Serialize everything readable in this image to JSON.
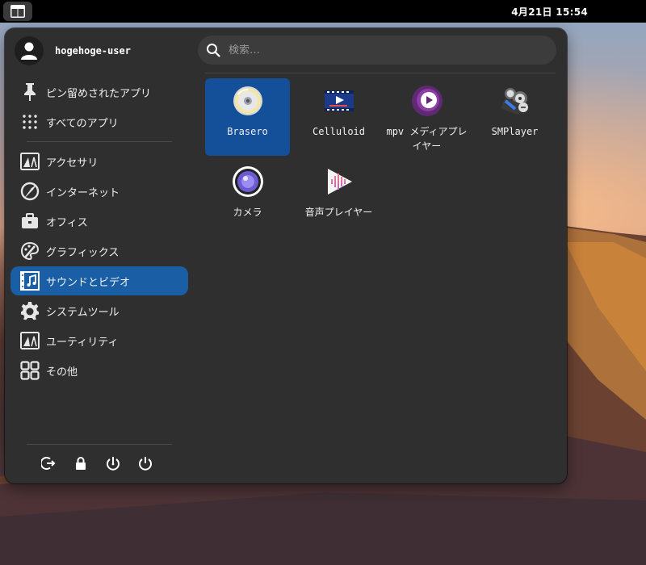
{
  "topbar": {
    "clock": "4月21日  15:54"
  },
  "user": {
    "name": "hogehoge-user"
  },
  "search": {
    "placeholder": "検索…"
  },
  "categories": [
    {
      "label": "ピン留めされたアプリ",
      "icon": "pin-icon"
    },
    {
      "label": "すべてのアプリ",
      "icon": "grid-dots-icon"
    },
    {
      "label": "アクセサリ",
      "icon": "accessories-icon"
    },
    {
      "label": "インターネット",
      "icon": "internet-icon"
    },
    {
      "label": "オフィス",
      "icon": "office-briefcase-icon"
    },
    {
      "label": "グラフィックス",
      "icon": "graphics-palette-icon"
    },
    {
      "label": "サウンドとビデオ",
      "icon": "sound-video-icon",
      "active": true
    },
    {
      "label": "システムツール",
      "icon": "gear-icon"
    },
    {
      "label": "ユーティリティ",
      "icon": "utilities-icon"
    },
    {
      "label": "その他",
      "icon": "other-apps-icon"
    }
  ],
  "apps": [
    {
      "label": "Brasero",
      "icon": "brasero-disc-icon",
      "selected": true
    },
    {
      "label": "Celluloid",
      "icon": "celluloid-icon"
    },
    {
      "label": "mpv メディアプレイヤー",
      "icon": "mpv-icon"
    },
    {
      "label": "SMPlayer",
      "icon": "smplayer-icon"
    },
    {
      "label": "カメラ",
      "icon": "camera-icon"
    },
    {
      "label": "音声プレイヤー",
      "icon": "audio-player-icon"
    }
  ],
  "power_icons": [
    "logout-icon",
    "lock-icon",
    "restart-icon",
    "power-icon"
  ],
  "colors": {
    "accent": "#1a5fa6",
    "menu_bg": "#2f2f2f",
    "topbar_bg": "#000000"
  }
}
